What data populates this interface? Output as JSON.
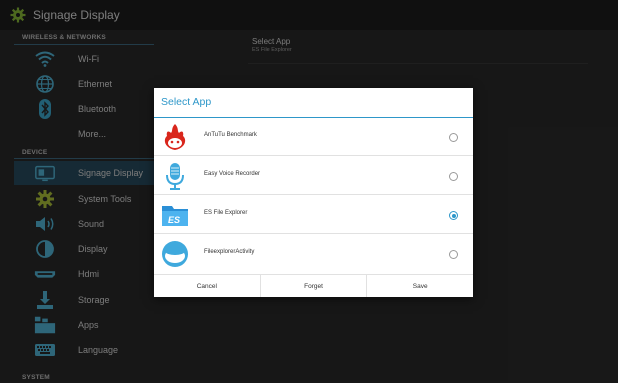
{
  "window": {
    "title": "Signage Display",
    "icon": "gear-icon"
  },
  "sidebar": {
    "sections": [
      {
        "label": "WIRELESS & NETWORKS"
      },
      {
        "label": "DEVICE"
      },
      {
        "label": "SYSTEM"
      }
    ],
    "items": [
      {
        "label": "Wi-Fi",
        "icon": "wifi-icon"
      },
      {
        "label": "Ethernet",
        "icon": "ethernet-icon"
      },
      {
        "label": "Bluetooth",
        "icon": "bluetooth-icon"
      },
      {
        "label": "More...",
        "icon": ""
      },
      {
        "label": "Signage Display",
        "icon": "signage-display-icon",
        "active": true
      },
      {
        "label": "System Tools",
        "icon": "system-tools-icon"
      },
      {
        "label": "Sound",
        "icon": "sound-icon"
      },
      {
        "label": "Display",
        "icon": "display-icon"
      },
      {
        "label": "Hdmi",
        "icon": "hdmi-icon"
      },
      {
        "label": "Storage",
        "icon": "storage-icon"
      },
      {
        "label": "Apps",
        "icon": "apps-icon"
      },
      {
        "label": "Language",
        "icon": "language-icon"
      }
    ]
  },
  "detail": {
    "title": "Select App",
    "subtitle": "ES File Explorer"
  },
  "dialog": {
    "title": "Select App",
    "options": [
      {
        "label": "AnTuTu Benchmark",
        "icon": "antutu-benchmark-icon",
        "selected": false
      },
      {
        "label": "Easy Voice Recorder",
        "icon": "microphone-icon",
        "selected": false
      },
      {
        "label": "ES File Explorer",
        "icon": "es-file-explorer-icon",
        "selected": true
      },
      {
        "label": "FileexplorerActivity",
        "icon": "file-explorer-activity-icon",
        "selected": false
      }
    ],
    "buttons": {
      "cancel": "Cancel",
      "forget": "Forget",
      "save": "Save"
    }
  },
  "colors": {
    "accent": "#2e97c9",
    "active_item": "#2a4f62",
    "background": "#2c2c2c"
  }
}
